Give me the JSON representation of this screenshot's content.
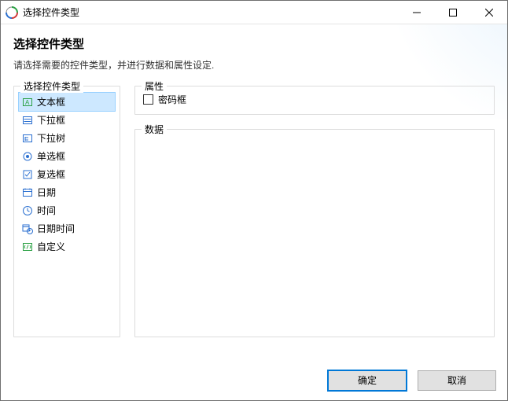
{
  "window": {
    "title": "选择控件类型"
  },
  "page": {
    "heading": "选择控件类型",
    "subheading": "请选择需要的控件类型，并进行数据和属性设定."
  },
  "left": {
    "legend": "选择控件类型",
    "items": [
      {
        "label": "文本框",
        "icon": "textbox-icon",
        "selected": true
      },
      {
        "label": "下拉框",
        "icon": "dropdown-icon",
        "selected": false
      },
      {
        "label": "下拉树",
        "icon": "tree-icon",
        "selected": false
      },
      {
        "label": "单选框",
        "icon": "radio-icon",
        "selected": false
      },
      {
        "label": "复选框",
        "icon": "check-icon",
        "selected": false
      },
      {
        "label": "日期",
        "icon": "date-icon",
        "selected": false
      },
      {
        "label": "时间",
        "icon": "time-icon",
        "selected": false
      },
      {
        "label": "日期时间",
        "icon": "datetime-icon",
        "selected": false
      },
      {
        "label": "自定义",
        "icon": "custom-icon",
        "selected": false
      }
    ]
  },
  "attrs": {
    "legend": "属性",
    "password_label": "密码框",
    "password_checked": false
  },
  "dataPane": {
    "legend": "数据"
  },
  "footer": {
    "ok": "确定",
    "cancel": "取消"
  }
}
